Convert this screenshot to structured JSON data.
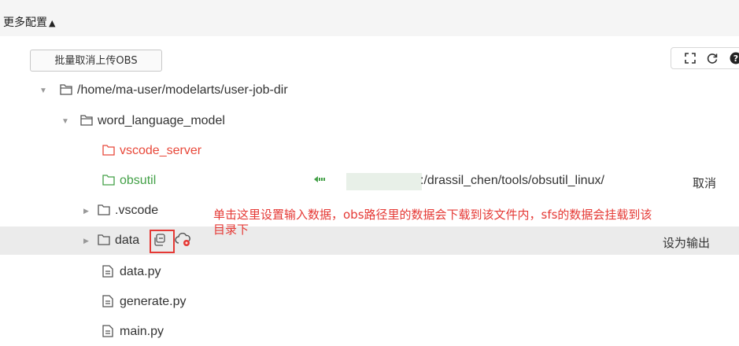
{
  "header": {
    "title": "更多配置",
    "caret": "▲"
  },
  "toolbar": {
    "batch_cancel_label": "批量取消上传OBS"
  },
  "tree": {
    "root_path": "/home/ma-user/modelarts/user-job-dir",
    "model_folder": "word_language_model",
    "items": [
      {
        "label": "vscode_server"
      },
      {
        "label": "obsutil",
        "obs_path": ":/drassil_chen/tools/obsutil_linux/",
        "action": "取消"
      },
      {
        "label": ".vscode"
      },
      {
        "label": "data",
        "action": "设为输出"
      },
      {
        "label": "data.py"
      },
      {
        "label": "generate.py"
      },
      {
        "label": "main.py"
      }
    ]
  },
  "annotation": {
    "text": "单击这里设置输入数据，obs路径里的数据会下载到该文件内，sfs的数据会挂载到该目录下"
  },
  "colors": {
    "red_label": "#e8483a",
    "green_label": "#43a047",
    "annotation_red": "#e53935",
    "highlight_row": "#ebebeb"
  }
}
